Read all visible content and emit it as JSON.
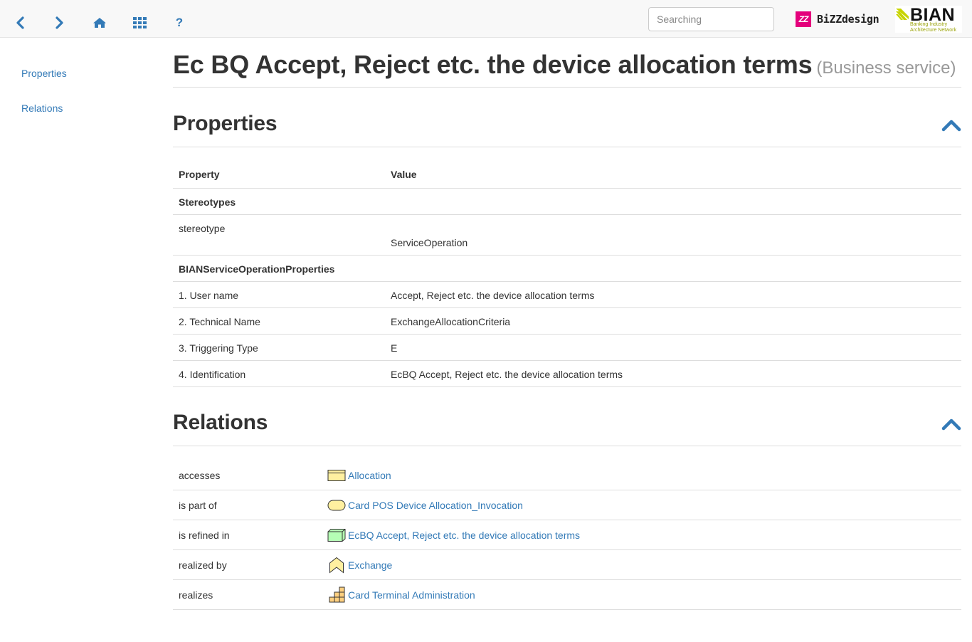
{
  "toolbar": {
    "search_placeholder": "Searching",
    "bizzdesign_logo_text": "BiZZdesign",
    "bian_logo_text": "BIAN",
    "bian_logo_subtitle_1": "Banking Industry",
    "bian_logo_subtitle_2": "Architecture Network",
    "help_label": "?"
  },
  "sidebar": {
    "items": [
      {
        "label": "Properties"
      },
      {
        "label": "Relations"
      }
    ]
  },
  "header": {
    "title": "Ec BQ Accept, Reject etc. the device allocation terms",
    "subtitle": "(Business service)"
  },
  "properties": {
    "heading": "Properties",
    "columns": {
      "property": "Property",
      "value": "Value"
    },
    "rows": [
      {
        "group": "Stereotypes"
      },
      {
        "property": "stereotype",
        "value": "ServiceOperation"
      },
      {
        "group": "BIANServiceOperationProperties"
      },
      {
        "property": "1. User name",
        "value": "Accept, Reject etc. the device allocation terms"
      },
      {
        "property": "2. Technical Name",
        "value": "ExchangeAllocationCriteria"
      },
      {
        "property": "3. Triggering Type",
        "value": "E"
      },
      {
        "property": "4. Identification",
        "value": "EcBQ Accept, Reject etc. the device allocation terms"
      }
    ]
  },
  "relations": {
    "heading": "Relations",
    "rows": [
      {
        "relation": "accesses",
        "target": "Allocation",
        "icon": "business-object-icon"
      },
      {
        "relation": "is part of",
        "target": "Card POS Device Allocation_Invocation",
        "icon": "business-service-icon"
      },
      {
        "relation": "is refined in",
        "target": "EcBQ Accept, Reject etc. the device allocation terms",
        "icon": "node-icon"
      },
      {
        "relation": "realized by",
        "target": "Exchange",
        "icon": "value-stream-icon"
      },
      {
        "relation": "realizes",
        "target": "Card Terminal Administration",
        "icon": "capability-icon"
      }
    ]
  },
  "colors": {
    "link": "#337ab7",
    "bizzdesign_brand": "#e4007c",
    "bian_accent": "#c8d400",
    "business_object": "#fff0a0",
    "node": "#b5ffb5"
  }
}
